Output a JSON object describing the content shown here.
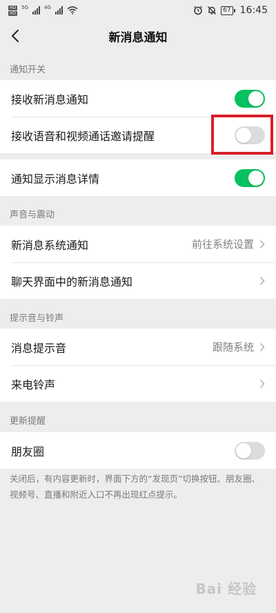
{
  "status_bar": {
    "sim1": "HD",
    "sim2": "HD",
    "net1": "5G",
    "net2": "4G",
    "battery": "67",
    "time": "16:45"
  },
  "nav": {
    "title": "新消息通知",
    "back_icon": "chevron-left-icon"
  },
  "sections": {
    "notify_switch": {
      "label": "通知开关",
      "rows": [
        {
          "label": "接收新消息通知",
          "toggle": "on"
        },
        {
          "label": "接收语音和视频通话邀请提醒",
          "toggle": "off"
        }
      ]
    },
    "detail": {
      "rows": [
        {
          "label": "通知显示消息详情",
          "toggle": "on"
        }
      ]
    },
    "sound": {
      "label": "声音与震动",
      "rows": [
        {
          "label": "新消息系统通知",
          "value": "前往系统设置"
        },
        {
          "label": "聊天界面中的新消息通知",
          "value": ""
        }
      ]
    },
    "ringtone": {
      "label": "提示音与铃声",
      "rows": [
        {
          "label": "消息提示音",
          "value": "跟随系统"
        },
        {
          "label": "来电铃声",
          "value": ""
        }
      ]
    },
    "update": {
      "label": "更新提醒",
      "rows": [
        {
          "label": "朋友圈",
          "toggle": "off"
        }
      ],
      "footnote": "关闭后，有内容更新时，界面下方的“发现页”切换按钮、朋友圈、视频号、直播和附近入口不再出现红点提示。"
    }
  },
  "watermark": "Bai 经验",
  "colors": {
    "toggle_on": "#07c160",
    "toggle_off": "#dcdcdc",
    "highlight": "#d8202a",
    "background": "#ededed"
  }
}
